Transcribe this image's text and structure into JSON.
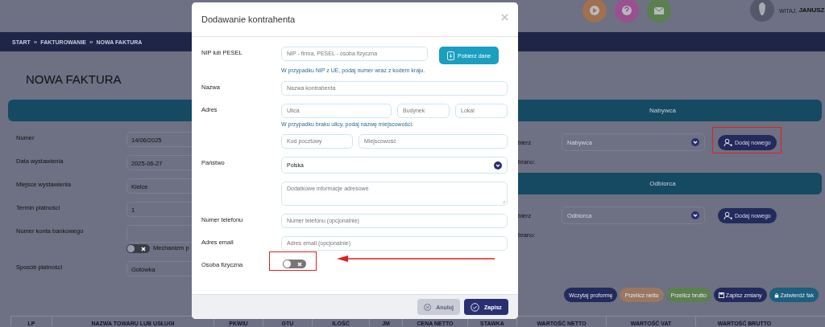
{
  "header": {
    "greeting": "WITAJ,",
    "user": "JANUSZ"
  },
  "breadcrumb": [
    {
      "label": "START",
      "separator": "»"
    },
    {
      "label": "FAKTUROWANIE",
      "separator": "»"
    },
    {
      "label": "NOWA FAKTURA"
    }
  ],
  "page_title": "NOWA FAKTURA",
  "invoice_fields": [
    {
      "kind": "input",
      "label": "Numer",
      "value": "14/06/2025"
    },
    {
      "kind": "input",
      "label": "Data wystawienia",
      "value": "2025-06-27"
    },
    {
      "kind": "input",
      "label": "Miejsce wystawienia",
      "value": "Kielce"
    },
    {
      "kind": "input",
      "label": "Termin płatności",
      "value": "1"
    },
    {
      "kind": "input",
      "label": "Numer konta bankowego"
    },
    {
      "kind": "toggle",
      "label": "Mechanizm p",
      "on": false
    },
    {
      "kind": "input",
      "label": "Sposób płatności",
      "value": "Gotówka"
    }
  ],
  "parties": [
    {
      "title": "Nabywca",
      "select_label": "bierz",
      "placeholder": "Nabywca",
      "button": "Dodaj nowego",
      "chosen_label": "brano:"
    },
    {
      "title": "Odbiorca",
      "select_label": "bierz",
      "placeholder": "Odbiorca",
      "button": "Dodaj nowego",
      "chosen_label": "brano:"
    }
  ],
  "actions": [
    {
      "kind": "plain",
      "label": "Wczytaj proformę",
      "color": "#232a5c"
    },
    {
      "kind": "plain",
      "label": "Przelicz netto",
      "color": "#9a7760"
    },
    {
      "kind": "plain",
      "label": "Przelicz brutto",
      "color": "#5c8050"
    },
    {
      "kind": "save",
      "label": "Zapisz zmiany",
      "color": "#232a5c"
    },
    {
      "kind": "lock",
      "label": "Zatwierdź fak",
      "color": "#1c5f7e"
    }
  ],
  "table": {
    "columns": [
      "LP",
      "NAZWA TOWARU LUB USŁUGI",
      "PKWIU",
      "GTU",
      "ILOŚĆ",
      "JM",
      "CENA NETTO",
      "STAWKA",
      "WARTOŚĆ NETTO",
      "WARTOŚĆ VAT",
      "WARTOŚĆ BRUTTO"
    ]
  },
  "dialog": {
    "title": "Dodawanie kontrahenta",
    "fields": [
      {
        "kind": "nip",
        "label": "NIP lub PESEL",
        "placeholder": "NIP - firma, PESEL - osoba fizyczna",
        "button": "Pobierz dane",
        "hint": "W przypadku NIP z UE, podaj numer wraz z kodem kraju."
      },
      {
        "kind": "text",
        "label": "Nazwa",
        "placeholder": "Nazwa kontrahenta"
      },
      {
        "kind": "address",
        "label": "Adres",
        "placeholders": [
          "Ulica",
          "Budynek",
          "Lokal"
        ],
        "hint": "W przypadku braku ulicy, podaj nazwę miejscowości.",
        "placeholders_2": [
          "Kod pocztowy",
          "Miejscowość"
        ]
      },
      {
        "kind": "select",
        "label": "Państwo",
        "value": "Polska"
      },
      {
        "kind": "textarea",
        "placeholder": "Dodatkowe informacje adresowe"
      },
      {
        "kind": "text",
        "label": "Numer telefonu",
        "placeholder": "Numer telefonu (opcjonalnie)"
      },
      {
        "kind": "text",
        "label": "Adres email",
        "placeholder": "Adres email (opcjonalnie)"
      },
      {
        "kind": "toggle",
        "label": "Osoba fizyczna",
        "on": false
      }
    ],
    "buttons": [
      {
        "kind": "cancel",
        "label": "Anuluj"
      },
      {
        "kind": "confirm",
        "label": "Zapisz"
      }
    ]
  }
}
